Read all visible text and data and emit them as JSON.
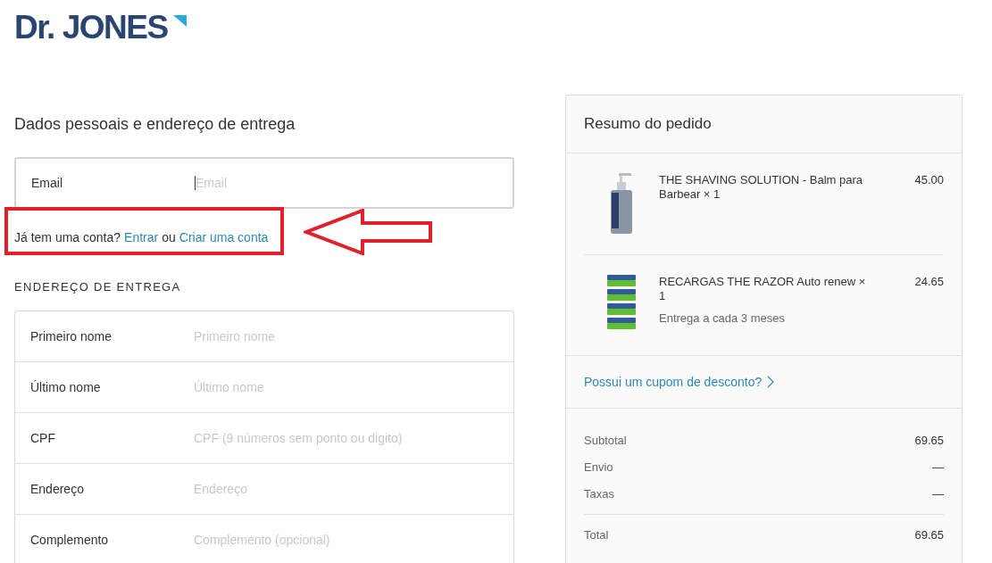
{
  "logo": {
    "text": "Dr. JONES"
  },
  "checkout": {
    "title": "Dados pessoais e endereço de entrega",
    "email": {
      "label": "Email",
      "placeholder": "Email",
      "focused": true
    },
    "account_prompt": {
      "text": "Já tem uma conta?",
      "login_link": "Entrar",
      "separator": "ou",
      "signup_link": "Criar uma conta"
    },
    "section_title": "ENDEREÇO DE ENTREGA",
    "fields": [
      {
        "label": "Primeiro nome",
        "placeholder": "Primeiro nome"
      },
      {
        "label": "Último nome",
        "placeholder": "Último nome"
      },
      {
        "label": "CPF",
        "placeholder": "CPF (9 números sem ponto ou digito)"
      },
      {
        "label": "Endereço",
        "placeholder": "Endereço"
      },
      {
        "label": "Complemento",
        "placeholder": "Complemento (opcional)"
      }
    ]
  },
  "summary": {
    "title": "Resumo do pedido",
    "items": [
      {
        "kind": "bottle",
        "name": "THE SHAVING SOLUTION - Balm para Barbear × 1",
        "price": "45.00"
      },
      {
        "kind": "cartridges",
        "name": "RECARGAS THE RAZOR Auto renew × 1",
        "note": "Entrega a cada 3 meses",
        "price": "24.65"
      }
    ],
    "coupon_link": "Possui um cupom de desconto?",
    "lines": [
      {
        "label": "Subtotal",
        "value": "69.65"
      },
      {
        "label": "Envio",
        "value": "—"
      },
      {
        "label": "Taxas",
        "value": "—"
      }
    ],
    "total": {
      "label": "Total",
      "value": "69.65"
    }
  },
  "annotation": {
    "highlight": true
  }
}
